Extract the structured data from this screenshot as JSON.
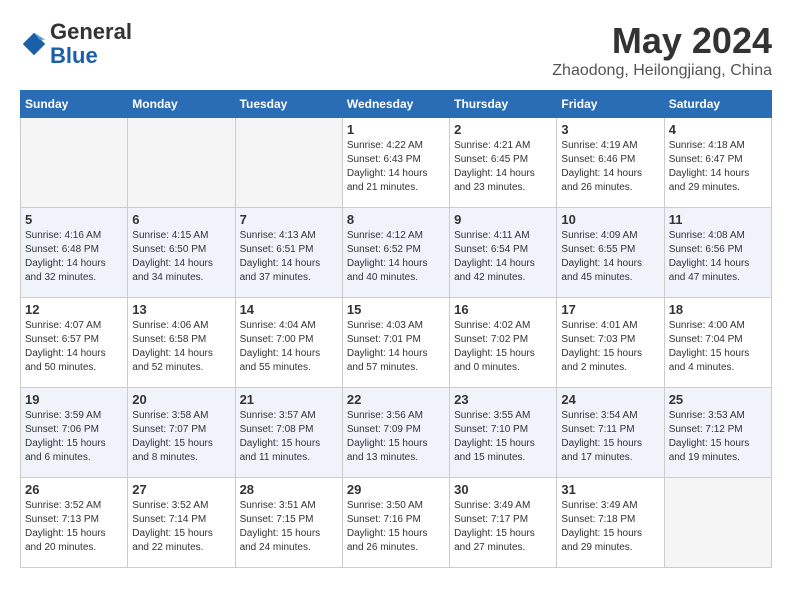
{
  "header": {
    "logo_general": "General",
    "logo_blue": "Blue",
    "month_year": "May 2024",
    "location": "Zhaodong, Heilongjiang, China"
  },
  "weekdays": [
    "Sunday",
    "Monday",
    "Tuesday",
    "Wednesday",
    "Thursday",
    "Friday",
    "Saturday"
  ],
  "weeks": [
    [
      {
        "day": "",
        "sunrise": "",
        "sunset": "",
        "daylight": "",
        "empty": true
      },
      {
        "day": "",
        "sunrise": "",
        "sunset": "",
        "daylight": "",
        "empty": true
      },
      {
        "day": "",
        "sunrise": "",
        "sunset": "",
        "daylight": "",
        "empty": true
      },
      {
        "day": "1",
        "sunrise": "Sunrise: 4:22 AM",
        "sunset": "Sunset: 6:43 PM",
        "daylight": "Daylight: 14 hours and 21 minutes.",
        "empty": false
      },
      {
        "day": "2",
        "sunrise": "Sunrise: 4:21 AM",
        "sunset": "Sunset: 6:45 PM",
        "daylight": "Daylight: 14 hours and 23 minutes.",
        "empty": false
      },
      {
        "day": "3",
        "sunrise": "Sunrise: 4:19 AM",
        "sunset": "Sunset: 6:46 PM",
        "daylight": "Daylight: 14 hours and 26 minutes.",
        "empty": false
      },
      {
        "day": "4",
        "sunrise": "Sunrise: 4:18 AM",
        "sunset": "Sunset: 6:47 PM",
        "daylight": "Daylight: 14 hours and 29 minutes.",
        "empty": false
      }
    ],
    [
      {
        "day": "5",
        "sunrise": "Sunrise: 4:16 AM",
        "sunset": "Sunset: 6:48 PM",
        "daylight": "Daylight: 14 hours and 32 minutes.",
        "empty": false
      },
      {
        "day": "6",
        "sunrise": "Sunrise: 4:15 AM",
        "sunset": "Sunset: 6:50 PM",
        "daylight": "Daylight: 14 hours and 34 minutes.",
        "empty": false
      },
      {
        "day": "7",
        "sunrise": "Sunrise: 4:13 AM",
        "sunset": "Sunset: 6:51 PM",
        "daylight": "Daylight: 14 hours and 37 minutes.",
        "empty": false
      },
      {
        "day": "8",
        "sunrise": "Sunrise: 4:12 AM",
        "sunset": "Sunset: 6:52 PM",
        "daylight": "Daylight: 14 hours and 40 minutes.",
        "empty": false
      },
      {
        "day": "9",
        "sunrise": "Sunrise: 4:11 AM",
        "sunset": "Sunset: 6:54 PM",
        "daylight": "Daylight: 14 hours and 42 minutes.",
        "empty": false
      },
      {
        "day": "10",
        "sunrise": "Sunrise: 4:09 AM",
        "sunset": "Sunset: 6:55 PM",
        "daylight": "Daylight: 14 hours and 45 minutes.",
        "empty": false
      },
      {
        "day": "11",
        "sunrise": "Sunrise: 4:08 AM",
        "sunset": "Sunset: 6:56 PM",
        "daylight": "Daylight: 14 hours and 47 minutes.",
        "empty": false
      }
    ],
    [
      {
        "day": "12",
        "sunrise": "Sunrise: 4:07 AM",
        "sunset": "Sunset: 6:57 PM",
        "daylight": "Daylight: 14 hours and 50 minutes.",
        "empty": false
      },
      {
        "day": "13",
        "sunrise": "Sunrise: 4:06 AM",
        "sunset": "Sunset: 6:58 PM",
        "daylight": "Daylight: 14 hours and 52 minutes.",
        "empty": false
      },
      {
        "day": "14",
        "sunrise": "Sunrise: 4:04 AM",
        "sunset": "Sunset: 7:00 PM",
        "daylight": "Daylight: 14 hours and 55 minutes.",
        "empty": false
      },
      {
        "day": "15",
        "sunrise": "Sunrise: 4:03 AM",
        "sunset": "Sunset: 7:01 PM",
        "daylight": "Daylight: 14 hours and 57 minutes.",
        "empty": false
      },
      {
        "day": "16",
        "sunrise": "Sunrise: 4:02 AM",
        "sunset": "Sunset: 7:02 PM",
        "daylight": "Daylight: 15 hours and 0 minutes.",
        "empty": false
      },
      {
        "day": "17",
        "sunrise": "Sunrise: 4:01 AM",
        "sunset": "Sunset: 7:03 PM",
        "daylight": "Daylight: 15 hours and 2 minutes.",
        "empty": false
      },
      {
        "day": "18",
        "sunrise": "Sunrise: 4:00 AM",
        "sunset": "Sunset: 7:04 PM",
        "daylight": "Daylight: 15 hours and 4 minutes.",
        "empty": false
      }
    ],
    [
      {
        "day": "19",
        "sunrise": "Sunrise: 3:59 AM",
        "sunset": "Sunset: 7:06 PM",
        "daylight": "Daylight: 15 hours and 6 minutes.",
        "empty": false
      },
      {
        "day": "20",
        "sunrise": "Sunrise: 3:58 AM",
        "sunset": "Sunset: 7:07 PM",
        "daylight": "Daylight: 15 hours and 8 minutes.",
        "empty": false
      },
      {
        "day": "21",
        "sunrise": "Sunrise: 3:57 AM",
        "sunset": "Sunset: 7:08 PM",
        "daylight": "Daylight: 15 hours and 11 minutes.",
        "empty": false
      },
      {
        "day": "22",
        "sunrise": "Sunrise: 3:56 AM",
        "sunset": "Sunset: 7:09 PM",
        "daylight": "Daylight: 15 hours and 13 minutes.",
        "empty": false
      },
      {
        "day": "23",
        "sunrise": "Sunrise: 3:55 AM",
        "sunset": "Sunset: 7:10 PM",
        "daylight": "Daylight: 15 hours and 15 minutes.",
        "empty": false
      },
      {
        "day": "24",
        "sunrise": "Sunrise: 3:54 AM",
        "sunset": "Sunset: 7:11 PM",
        "daylight": "Daylight: 15 hours and 17 minutes.",
        "empty": false
      },
      {
        "day": "25",
        "sunrise": "Sunrise: 3:53 AM",
        "sunset": "Sunset: 7:12 PM",
        "daylight": "Daylight: 15 hours and 19 minutes.",
        "empty": false
      }
    ],
    [
      {
        "day": "26",
        "sunrise": "Sunrise: 3:52 AM",
        "sunset": "Sunset: 7:13 PM",
        "daylight": "Daylight: 15 hours and 20 minutes.",
        "empty": false
      },
      {
        "day": "27",
        "sunrise": "Sunrise: 3:52 AM",
        "sunset": "Sunset: 7:14 PM",
        "daylight": "Daylight: 15 hours and 22 minutes.",
        "empty": false
      },
      {
        "day": "28",
        "sunrise": "Sunrise: 3:51 AM",
        "sunset": "Sunset: 7:15 PM",
        "daylight": "Daylight: 15 hours and 24 minutes.",
        "empty": false
      },
      {
        "day": "29",
        "sunrise": "Sunrise: 3:50 AM",
        "sunset": "Sunset: 7:16 PM",
        "daylight": "Daylight: 15 hours and 26 minutes.",
        "empty": false
      },
      {
        "day": "30",
        "sunrise": "Sunrise: 3:49 AM",
        "sunset": "Sunset: 7:17 PM",
        "daylight": "Daylight: 15 hours and 27 minutes.",
        "empty": false
      },
      {
        "day": "31",
        "sunrise": "Sunrise: 3:49 AM",
        "sunset": "Sunset: 7:18 PM",
        "daylight": "Daylight: 15 hours and 29 minutes.",
        "empty": false
      },
      {
        "day": "",
        "sunrise": "",
        "sunset": "",
        "daylight": "",
        "empty": true
      }
    ]
  ]
}
